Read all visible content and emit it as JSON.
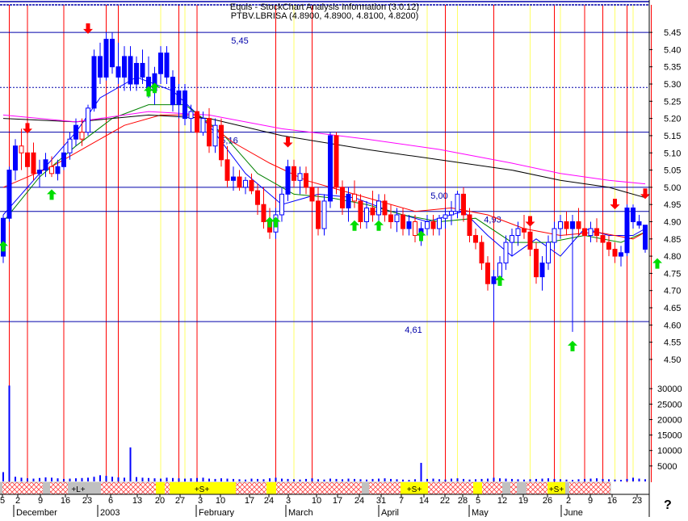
{
  "header": {
    "title": "Equis - StockChart Analysis Information (3.0.12)",
    "subtitle": "PTBV.LBRISA (4.8900, 4.8900, 4.8100, 4.8200)"
  },
  "help_label": "?",
  "colors": {
    "up": "#0000ff",
    "down": "#ff0000",
    "outlined": "#ff0000",
    "ma_fast": "#0000ff",
    "ma_mid": "#008000",
    "ma_slow": "#ff0000",
    "ma_long": "#000000",
    "ma_longest": "#ff00ff",
    "volume": "#0000ff",
    "vline_red": "#ff0000",
    "vline_yellow": "#ffff66",
    "hline": "#0000aa",
    "arrow_up": "#00dd00",
    "arrow_down": "#ff0000",
    "band_hatch": "#ff4040",
    "band_yellow": "#ffff00",
    "band_gray": "#c0c0c0"
  },
  "chart_data": {
    "type": "candlestick",
    "price_ticks": [
      "5.45",
      "5.40",
      "5.35",
      "5.30",
      "5.25",
      "5.20",
      "5.15",
      "5.10",
      "5.05",
      "5.00",
      "4.95",
      "4.90",
      "4.85",
      "4.80",
      "4.75",
      "4.70",
      "4.65",
      "4.60",
      "4.55",
      "4.50"
    ],
    "price_range": [
      4.46,
      5.53
    ],
    "volume_ticks": [
      "30000",
      "25000",
      "20000",
      "15000",
      "10000",
      "5000"
    ],
    "volume_range": [
      0,
      35000
    ],
    "date_ticks": [
      "5",
      "2",
      "9",
      "16",
      "23",
      "6",
      "13",
      "20",
      "27",
      "3",
      "10",
      "17",
      "24",
      "3",
      "10",
      "17",
      "24",
      "31",
      "7",
      "14",
      "22",
      "28",
      "5",
      "12",
      "19",
      "26",
      "2",
      "9",
      "16",
      "23"
    ],
    "month_labels": [
      "December",
      "2003",
      "February",
      "March",
      "April",
      "May",
      "June"
    ],
    "level_lines": [
      5.45,
      5.29,
      5.16,
      5.0,
      4.93,
      4.61
    ],
    "level_labels": [
      "5,45",
      "5,16",
      "5,00",
      "4,93",
      "4,61"
    ],
    "band_labels": [
      "+L+",
      "+S+",
      "+S+",
      "+S+"
    ],
    "bars": [
      [
        4.8,
        4.92,
        4.78,
        4.91
      ],
      [
        4.91,
        5.06,
        4.9,
        5.05
      ],
      [
        5.05,
        5.14,
        5.02,
        5.12
      ],
      [
        5.12,
        5.17,
        5.05,
        5.1
      ],
      [
        5.1,
        5.16,
        5.04,
        5.06
      ],
      [
        5.1,
        5.13,
        5.02,
        5.04
      ],
      [
        5.04,
        5.08,
        5.0,
        5.05
      ],
      [
        5.05,
        5.1,
        5.03,
        5.08
      ],
      [
        5.06,
        5.09,
        5.03,
        5.04
      ],
      [
        5.04,
        5.08,
        5.02,
        5.06
      ],
      [
        5.06,
        5.12,
        5.05,
        5.1
      ],
      [
        5.1,
        5.16,
        5.08,
        5.14
      ],
      [
        5.14,
        5.2,
        5.12,
        5.18
      ],
      [
        5.16,
        5.2,
        5.12,
        5.14
      ],
      [
        5.16,
        5.24,
        5.15,
        5.23
      ],
      [
        5.23,
        5.4,
        5.22,
        5.38
      ],
      [
        5.38,
        5.42,
        5.3,
        5.32
      ],
      [
        5.32,
        5.45,
        5.31,
        5.43
      ],
      [
        5.43,
        5.45,
        5.33,
        5.35
      ],
      [
        5.35,
        5.42,
        5.3,
        5.32
      ],
      [
        5.32,
        5.41,
        5.28,
        5.38
      ],
      [
        5.38,
        5.41,
        5.28,
        5.3
      ],
      [
        5.3,
        5.38,
        5.28,
        5.36
      ],
      [
        5.36,
        5.4,
        5.3,
        5.32
      ],
      [
        5.32,
        5.38,
        5.26,
        5.28
      ],
      [
        5.28,
        5.35,
        5.24,
        5.33
      ],
      [
        5.33,
        5.41,
        5.3,
        5.39
      ],
      [
        5.39,
        5.41,
        5.3,
        5.32
      ],
      [
        5.32,
        5.34,
        5.22,
        5.24
      ],
      [
        5.24,
        5.3,
        5.2,
        5.28
      ],
      [
        5.28,
        5.3,
        5.18,
        5.2
      ],
      [
        5.2,
        5.24,
        5.16,
        5.22
      ],
      [
        5.22,
        5.24,
        5.14,
        5.16
      ],
      [
        5.16,
        5.22,
        5.15,
        5.2
      ],
      [
        5.2,
        5.23,
        5.1,
        5.12
      ],
      [
        5.12,
        5.2,
        5.1,
        5.18
      ],
      [
        5.18,
        5.2,
        5.06,
        5.08
      ],
      [
        5.08,
        5.12,
        5.0,
        5.02
      ],
      [
        5.02,
        5.06,
        4.99,
        5.03
      ],
      [
        5.03,
        5.05,
        4.99,
        5.0
      ],
      [
        5.0,
        5.03,
        4.98,
        5.02
      ],
      [
        5.02,
        5.04,
        4.98,
        4.99
      ],
      [
        4.99,
        5.01,
        4.92,
        4.95
      ],
      [
        4.95,
        5.0,
        4.88,
        4.9
      ],
      [
        4.9,
        4.94,
        4.85,
        4.87
      ],
      [
        4.87,
        4.94,
        4.85,
        4.92
      ],
      [
        4.92,
        5.0,
        4.9,
        4.98
      ],
      [
        4.98,
        5.08,
        4.96,
        5.06
      ],
      [
        5.06,
        5.08,
        5.0,
        5.02
      ],
      [
        5.02,
        5.06,
        4.98,
        5.04
      ],
      [
        5.04,
        5.06,
        4.98,
        5.0
      ],
      [
        5.0,
        5.02,
        4.94,
        4.96
      ],
      [
        4.96,
        5.0,
        4.86,
        4.88
      ],
      [
        4.88,
        4.98,
        4.86,
        4.96
      ],
      [
        4.96,
        5.16,
        4.94,
        5.15
      ],
      [
        5.15,
        5.16,
        4.98,
        5.0
      ],
      [
        5.0,
        5.02,
        4.92,
        4.94
      ],
      [
        4.94,
        5.0,
        4.9,
        4.98
      ],
      [
        4.98,
        5.02,
        4.94,
        4.96
      ],
      [
        4.96,
        4.98,
        4.88,
        4.9
      ],
      [
        4.9,
        4.96,
        4.88,
        4.94
      ],
      [
        4.94,
        4.99,
        4.9,
        4.92
      ],
      [
        4.92,
        4.98,
        4.9,
        4.96
      ],
      [
        4.96,
        4.98,
        4.9,
        4.92
      ],
      [
        4.92,
        4.95,
        4.88,
        4.9
      ],
      [
        4.9,
        4.94,
        4.87,
        4.92
      ],
      [
        4.92,
        4.94,
        4.86,
        4.88
      ],
      [
        4.88,
        4.92,
        4.86,
        4.9
      ],
      [
        4.9,
        4.92,
        4.84,
        4.86
      ],
      [
        4.86,
        4.9,
        4.83,
        4.88
      ],
      [
        4.88,
        4.92,
        4.86,
        4.9
      ],
      [
        4.9,
        4.92,
        4.86,
        4.88
      ],
      [
        4.88,
        4.92,
        4.86,
        4.91
      ],
      [
        4.91,
        4.94,
        4.88,
        4.92
      ],
      [
        4.92,
        4.96,
        4.89,
        4.93
      ],
      [
        4.93,
        4.99,
        4.91,
        4.98
      ],
      [
        4.98,
        5.0,
        4.9,
        4.92
      ],
      [
        4.92,
        4.94,
        4.84,
        4.86
      ],
      [
        4.86,
        4.88,
        4.82,
        4.84
      ],
      [
        4.84,
        4.86,
        4.76,
        4.78
      ],
      [
        4.78,
        4.8,
        4.7,
        4.72
      ],
      [
        4.72,
        4.76,
        4.61,
        4.74
      ],
      [
        4.74,
        4.8,
        4.72,
        4.78
      ],
      [
        4.78,
        4.86,
        4.76,
        4.84
      ],
      [
        4.84,
        4.88,
        4.8,
        4.86
      ],
      [
        4.86,
        4.9,
        4.83,
        4.88
      ],
      [
        4.88,
        4.92,
        4.85,
        4.87
      ],
      [
        4.87,
        4.9,
        4.8,
        4.82
      ],
      [
        4.82,
        4.84,
        4.72,
        4.74
      ],
      [
        4.74,
        4.8,
        4.7,
        4.78
      ],
      [
        4.78,
        4.86,
        4.76,
        4.84
      ],
      [
        4.84,
        4.9,
        4.82,
        4.88
      ],
      [
        4.88,
        4.92,
        4.85,
        4.9
      ],
      [
        4.9,
        4.93,
        4.86,
        4.88
      ],
      [
        4.88,
        4.92,
        4.58,
        4.9
      ],
      [
        4.9,
        4.94,
        4.86,
        4.88
      ],
      [
        4.88,
        4.9,
        4.84,
        4.86
      ],
      [
        4.86,
        4.9,
        4.84,
        4.88
      ],
      [
        4.88,
        4.91,
        4.84,
        4.86
      ],
      [
        4.86,
        4.88,
        4.82,
        4.84
      ],
      [
        4.84,
        4.86,
        4.8,
        4.82
      ],
      [
        4.82,
        4.84,
        4.78,
        4.8
      ],
      [
        4.8,
        4.83,
        4.77,
        4.81
      ],
      [
        4.81,
        4.95,
        4.8,
        4.94
      ],
      [
        4.94,
        4.95,
        4.88,
        4.9
      ],
      [
        4.9,
        4.92,
        4.88,
        4.89
      ],
      [
        4.89,
        4.89,
        4.81,
        4.82
      ]
    ],
    "bar_styles": {
      "hollow": [
        3,
        8,
        11,
        13,
        14,
        17,
        21,
        22,
        26,
        29,
        31,
        33,
        35,
        40,
        45,
        46,
        49,
        53,
        58,
        60,
        62,
        65,
        68,
        70,
        72,
        73,
        74,
        75,
        82,
        83,
        84,
        85,
        90,
        91,
        92,
        97,
        104
      ],
      "solid_blue": [
        15,
        16,
        17,
        18,
        19,
        20,
        21,
        22,
        23,
        24,
        25,
        26,
        27,
        28,
        29,
        30,
        104,
        105,
        106
      ]
    },
    "volume": [
      3000,
      31000,
      1500,
      1200,
      1000,
      900,
      1100,
      1300,
      1200,
      1000,
      800,
      900,
      1000,
      1100,
      1200,
      1500,
      2000,
      1800,
      1500,
      1300,
      1200,
      11000,
      1400,
      1200,
      1100,
      1000,
      900,
      1200,
      1100,
      1000,
      900,
      1000,
      1100,
      1200,
      900,
      800,
      1000,
      900,
      800,
      700,
      600,
      900,
      800,
      700,
      1000,
      1200,
      900,
      800,
      700,
      600,
      800,
      1000,
      700,
      600,
      900,
      800,
      700,
      900,
      800,
      700,
      600,
      800,
      900,
      1000,
      800,
      700,
      600,
      500,
      700,
      6000,
      800,
      900,
      700,
      600,
      900,
      1000,
      800,
      600,
      700,
      800,
      900,
      1200,
      1000,
      900,
      800,
      700,
      600,
      700,
      800,
      900,
      1000,
      800,
      700,
      600,
      500,
      700,
      800,
      900,
      1000,
      800,
      700,
      600,
      500,
      800,
      1200,
      900,
      700
    ],
    "ma_series": {
      "ma_fast": [
        [
          0,
          4.92
        ],
        [
          6,
          5.04
        ],
        [
          12,
          5.16
        ],
        [
          16,
          5.26
        ],
        [
          22,
          5.32
        ],
        [
          28,
          5.28
        ],
        [
          34,
          5.18
        ],
        [
          40,
          5.04
        ],
        [
          46,
          4.95
        ],
        [
          52,
          4.98
        ],
        [
          58,
          4.97
        ],
        [
          64,
          4.93
        ],
        [
          70,
          4.9
        ],
        [
          76,
          4.93
        ],
        [
          80,
          4.86
        ],
        [
          84,
          4.8
        ],
        [
          88,
          4.85
        ],
        [
          92,
          4.8
        ],
        [
          96,
          4.88
        ],
        [
          100,
          4.86
        ],
        [
          104,
          4.86
        ],
        [
          106,
          4.88
        ]
      ],
      "ma_mid": [
        [
          0,
          4.9
        ],
        [
          6,
          5.03
        ],
        [
          12,
          5.12
        ],
        [
          18,
          5.2
        ],
        [
          24,
          5.24
        ],
        [
          30,
          5.24
        ],
        [
          36,
          5.16
        ],
        [
          42,
          5.04
        ],
        [
          48,
          4.98
        ],
        [
          54,
          4.97
        ],
        [
          60,
          4.95
        ],
        [
          66,
          4.92
        ],
        [
          72,
          4.9
        ],
        [
          78,
          4.91
        ],
        [
          84,
          4.84
        ],
        [
          90,
          4.84
        ],
        [
          96,
          4.86
        ],
        [
          102,
          4.84
        ],
        [
          106,
          4.87
        ]
      ],
      "ma_slow": [
        [
          0,
          5.0
        ],
        [
          8,
          5.06
        ],
        [
          14,
          5.12
        ],
        [
          20,
          5.18
        ],
        [
          26,
          5.21
        ],
        [
          32,
          5.21
        ],
        [
          38,
          5.13
        ],
        [
          44,
          5.07
        ],
        [
          50,
          5.02
        ],
        [
          56,
          4.99
        ],
        [
          62,
          4.96
        ],
        [
          68,
          4.93
        ],
        [
          74,
          4.94
        ],
        [
          80,
          4.92
        ],
        [
          86,
          4.88
        ],
        [
          92,
          4.86
        ],
        [
          98,
          4.87
        ],
        [
          104,
          4.85
        ],
        [
          106,
          4.87
        ]
      ],
      "ma_long": [
        [
          0,
          5.2
        ],
        [
          12,
          5.19
        ],
        [
          24,
          5.21
        ],
        [
          34,
          5.2
        ],
        [
          46,
          5.15
        ],
        [
          60,
          5.11
        ],
        [
          72,
          5.08
        ],
        [
          84,
          5.05
        ],
        [
          92,
          5.02
        ],
        [
          100,
          5.0
        ],
        [
          106,
          4.97
        ]
      ],
      "ma_longest": [
        [
          0,
          5.21
        ],
        [
          12,
          5.19
        ],
        [
          24,
          5.22
        ],
        [
          34,
          5.21
        ],
        [
          46,
          5.17
        ],
        [
          60,
          5.14
        ],
        [
          72,
          5.11
        ],
        [
          84,
          5.07
        ],
        [
          92,
          5.04
        ],
        [
          100,
          5.02
        ],
        [
          106,
          5.01
        ]
      ]
    },
    "buy_arrows": [
      [
        0,
        4.83
      ],
      [
        8,
        4.98
      ],
      [
        24,
        5.28
      ],
      [
        25,
        5.29
      ],
      [
        44,
        4.9
      ],
      [
        45,
        4.9
      ],
      [
        58,
        4.89
      ],
      [
        62,
        4.89
      ],
      [
        69,
        4.86
      ],
      [
        82,
        4.73
      ],
      [
        94,
        4.54
      ],
      [
        108,
        4.78
      ]
    ],
    "sell_arrows": [
      [
        4,
        5.17
      ],
      [
        14,
        5.46
      ],
      [
        47,
        5.13
      ],
      [
        87,
        4.9
      ],
      [
        101,
        4.95
      ],
      [
        106,
        4.98
      ]
    ],
    "red_vlines": [
      1,
      4,
      10,
      17,
      19,
      29,
      32,
      45,
      51,
      73,
      81,
      91,
      96,
      99,
      103,
      107
    ],
    "yellow_vlines": [
      26,
      30,
      48,
      70,
      75,
      87,
      92,
      101,
      104
    ]
  }
}
